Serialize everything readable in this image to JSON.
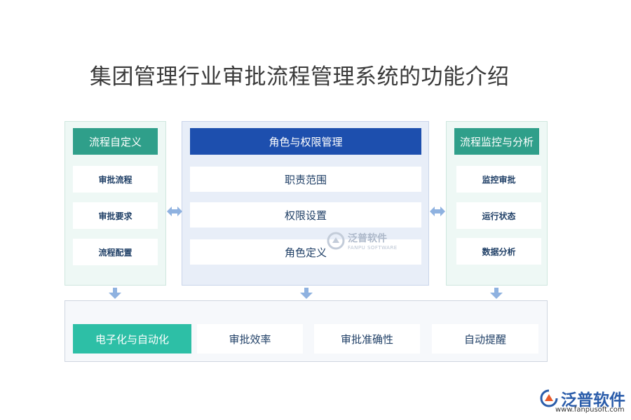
{
  "title": "集团管理行业审批流程管理系统的功能介绍",
  "left_panel": {
    "header": "流程自定义",
    "items": [
      "审批流程",
      "审批要求",
      "流程配置"
    ]
  },
  "mid_panel": {
    "header": "角色与权限管理",
    "items": [
      "职责范围",
      "权限设置",
      "角色定义"
    ]
  },
  "right_panel": {
    "header": "流程监控与分析",
    "items": [
      "监控审批",
      "运行状态",
      "数据分析"
    ]
  },
  "bottom_panel": {
    "items": [
      "电子化与自动化",
      "审批效率",
      "审批准确性",
      "自动提醒"
    ]
  },
  "watermark": {
    "text": "泛普软件",
    "sub": "FANPU SOFTWARE"
  },
  "logo": {
    "text": "泛普软件",
    "url": "www.fanpusoft.com"
  },
  "colors": {
    "teal_header": "#2f9f8a",
    "blue_header": "#1d4fae",
    "active_bottom": "#2dbfa6",
    "item_text": "#1f3f66",
    "arrow": "#8fb2e0"
  }
}
